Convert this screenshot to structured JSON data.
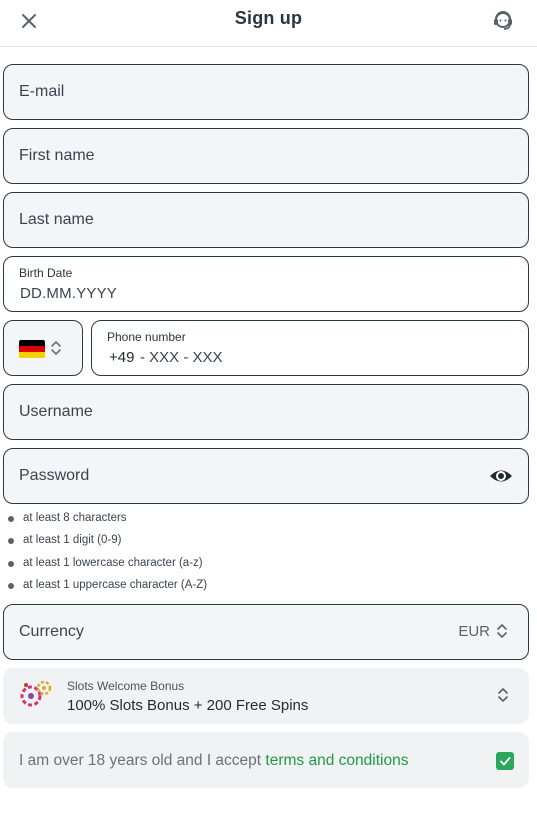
{
  "header": {
    "title": "Sign up",
    "close_icon": "close-icon",
    "support_icon": "headset-icon"
  },
  "form": {
    "email": {
      "placeholder": "E-mail"
    },
    "first_name": {
      "placeholder": "First name"
    },
    "last_name": {
      "placeholder": "Last name"
    },
    "birth_date": {
      "label": "Birth Date",
      "placeholder": "DD.MM.YYYY"
    },
    "country": {
      "flag": "germany-flag-icon",
      "colors": [
        "#000000",
        "#dd0000",
        "#ffce00"
      ]
    },
    "phone": {
      "label": "Phone number",
      "code": "+49",
      "mask": "- XXX - XXX"
    },
    "username": {
      "placeholder": "Username"
    },
    "password": {
      "placeholder": "Password",
      "toggle_icon": "eye-icon"
    },
    "password_rules": [
      "at least 8 characters",
      "at least 1 digit (0-9)",
      "at least 1 lowercase character (a-z)",
      "at least 1 uppercase character (A-Z)"
    ],
    "currency": {
      "placeholder": "Currency",
      "value": "EUR"
    },
    "bonus": {
      "title": "Slots Welcome Bonus",
      "value": "100% Slots Bonus + 200 Free Spins",
      "icon": "slots-bonus-icon"
    },
    "terms": {
      "text": "I am over 18 years old and I accept ",
      "link": "terms and conditions",
      "checked": true
    }
  },
  "colors": {
    "accent": "#1f9a4b",
    "checkbox": "#2aa75a",
    "border": "#2a3a44",
    "field_bg": "#f4f5f6"
  }
}
